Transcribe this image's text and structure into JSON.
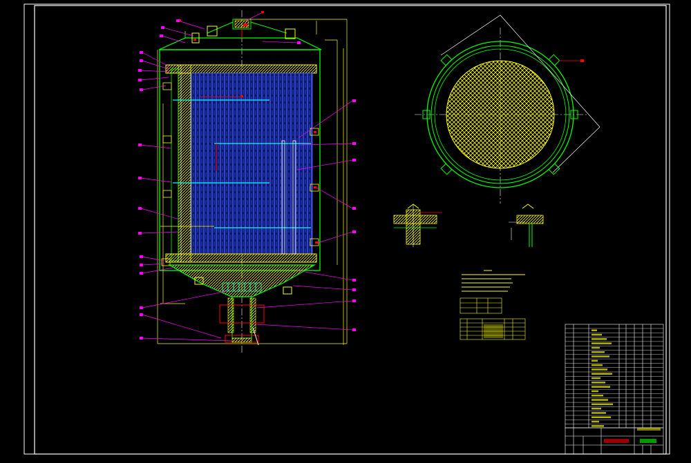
{
  "drawing": {
    "background": "#000000",
    "colors": {
      "frame": "#ffffff",
      "outline": "#00ff00",
      "hatch": "#ffff00",
      "tubes": "#3b4cff",
      "leader": "#ff00ff",
      "dimension": "#ffff00",
      "detail": "#ff0000",
      "cyan": "#00ffff",
      "centerline": "#ffffff"
    },
    "title_block": {
      "drawing_name_red": "",
      "drawing_name_green": ""
    }
  }
}
